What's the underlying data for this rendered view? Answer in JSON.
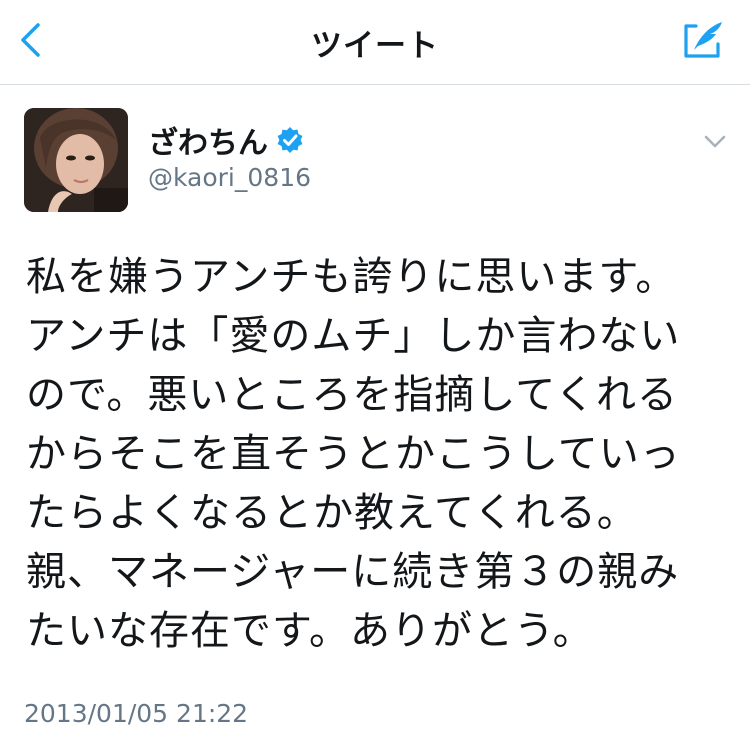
{
  "nav": {
    "title": "ツイート",
    "accent_color": "#1da1f2",
    "back_icon": "chevron-left-icon",
    "compose_icon": "compose-tweet-icon"
  },
  "tweet": {
    "author": {
      "display_name": "ざわちん",
      "handle": "@kaori_0816",
      "verified": true
    },
    "text": "私を嫌うアンチも誇りに思います。\nアンチは「愛のムチ」しか言わない\nので。悪いところを指摘してくれる\nからそこを直そうとかこうしていっ\nたらよくなるとか教えてくれる。\n親、マネージャーに続き第３の親み\nたいな存在です。ありがとう。",
    "timestamp": "2013/01/05 21:22"
  }
}
